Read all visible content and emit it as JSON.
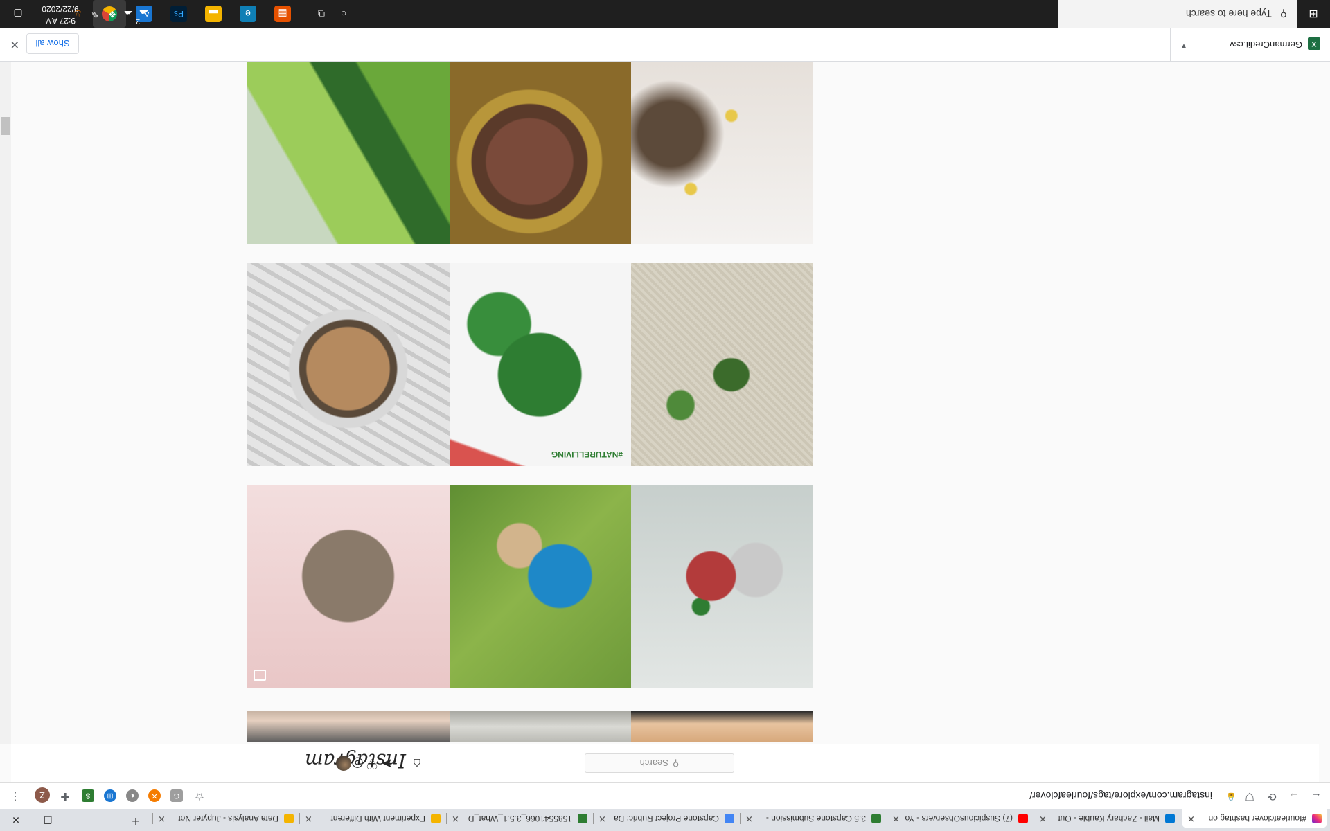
{
  "browser": {
    "tabs": [
      {
        "label": "#fourleafclover hashtag on",
        "active": true,
        "fav_color": "#d6249f"
      },
      {
        "label": "Mail - Zachary Kauble - Out",
        "active": false,
        "fav_color": "#0078d4"
      },
      {
        "label": "(7) SuspiciousObservers - Yo",
        "active": false,
        "fav_color": "#ff0000"
      },
      {
        "label": "3.5 Capstone Submission - ",
        "active": false,
        "fav_color": "#2e7d32"
      },
      {
        "label": "Capstone Project Rubric: Da",
        "active": false,
        "fav_color": "#4285f4"
      },
      {
        "label": "1585541066_3.5.1_What_D",
        "active": false,
        "fav_color": "#2e7d32"
      },
      {
        "label": "Experiment With Different",
        "active": false,
        "fav_color": "#f4b400"
      },
      {
        "label": "Data Analysis - Jupyter Not",
        "active": false,
        "fav_color": "#f4b400"
      }
    ],
    "new_tab_glyph": "+",
    "window_controls": {
      "minimize": "–",
      "restore": "❐",
      "close": "✕"
    },
    "url": "instagram.com/explore/tags/fourleafclover/",
    "back_glyph": "←",
    "forward_glyph": "→",
    "reload_glyph": "⟳",
    "menu_glyph": "⋮",
    "profile_initial": "Z",
    "extensions": [
      {
        "name": "grammarly-icon",
        "color": "#9e9e9e",
        "glyph": "G"
      },
      {
        "name": "orange-extension-icon",
        "color": "#f57c00",
        "glyph": "✕"
      },
      {
        "name": "gray-extension-icon",
        "color": "#888888",
        "glyph": "◐"
      },
      {
        "name": "blue-extension-icon",
        "color": "#1976d2",
        "glyph": "⊞"
      },
      {
        "name": "dollar-extension-icon",
        "color": "#2e7d32",
        "glyph": "$"
      },
      {
        "name": "puzzle-icon",
        "color": "#5f6368",
        "glyph": "✚"
      }
    ]
  },
  "instagram": {
    "logo": "Instagram",
    "search_placeholder": "Search",
    "search_glyph": "⚲",
    "nav_icons": [
      {
        "name": "home-icon",
        "glyph": "⌂"
      },
      {
        "name": "direct-icon",
        "glyph": "➤"
      },
      {
        "name": "explore-icon",
        "glyph": "◎"
      },
      {
        "name": "heart-icon",
        "glyph": "♡"
      }
    ],
    "grid": [
      {
        "name": "leaf-photo",
        "badge": false
      },
      {
        "name": "framed-etching-photo",
        "badge": false
      },
      {
        "name": "stars-sketch-photo",
        "badge": false
      },
      {
        "name": "coffee-cup-photo",
        "badge": false
      },
      {
        "name": "four-leaf-clover-photo",
        "badge": false,
        "caption": "#NATURELLIVING"
      },
      {
        "name": "clover-pendant-photo",
        "badge": false
      },
      {
        "name": "resin-cube-photo",
        "badge": true
      },
      {
        "name": "child-on-grass-photo",
        "badge": true
      },
      {
        "name": "clover-earrings-photo",
        "badge": false
      },
      {
        "name": "fingers-photo",
        "badge": false
      },
      {
        "name": "wood-plank-photo",
        "badge": false
      },
      {
        "name": "hand-photo",
        "badge": false
      }
    ]
  },
  "downloads": {
    "file_name": "GermanCredit.csv",
    "file_icon": "X",
    "show_all": "Show all",
    "close_glyph": "✕"
  },
  "taskbar": {
    "search_placeholder": "Type here to search",
    "clock_time": "9:27 AM",
    "clock_date": "9/22/2020",
    "badge_count": "2",
    "apps": [
      {
        "name": "cortana-icon",
        "glyph": "○",
        "color": "transparent"
      },
      {
        "name": "task-view-icon",
        "glyph": "⧉",
        "color": "transparent"
      },
      {
        "name": "office-app-icon",
        "glyph": "▦",
        "color": "#e65100"
      },
      {
        "name": "edge-icon",
        "glyph": "e",
        "color": "#0f7fb5"
      },
      {
        "name": "file-explorer-icon",
        "glyph": "▬",
        "color": "#f4b400"
      },
      {
        "name": "photoshop-icon",
        "glyph": "Ps",
        "color": "#001e36"
      },
      {
        "name": "photos-icon",
        "glyph": "☁",
        "color": "#1976d2"
      },
      {
        "name": "chrome-icon",
        "glyph": "◉",
        "color": "#2a6b2a"
      },
      {
        "name": "java-icon",
        "glyph": "♨",
        "color": "transparent"
      }
    ]
  }
}
